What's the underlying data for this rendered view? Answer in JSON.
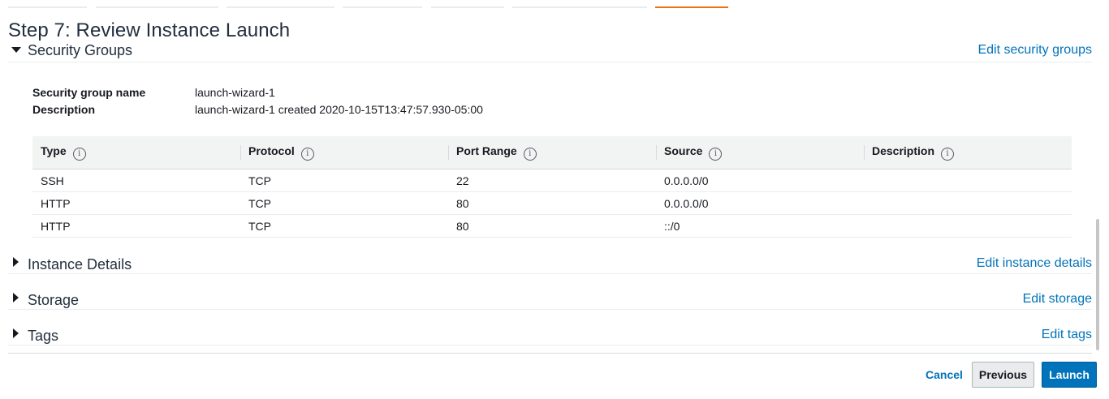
{
  "page": {
    "title": "Step 7: Review Instance Launch"
  },
  "security_groups": {
    "heading": "Security Groups",
    "edit_link": "Edit security groups",
    "name_key": "Security group name",
    "name_value": "launch-wizard-1",
    "desc_key": "Description",
    "desc_value": "launch-wizard-1 created 2020-10-15T13:47:57.930-05:00",
    "info_glyph": "i",
    "columns": [
      "Type",
      "Protocol",
      "Port Range",
      "Source",
      "Description"
    ],
    "rows": [
      {
        "type": "SSH",
        "protocol": "TCP",
        "port": "22",
        "source": "0.0.0.0/0",
        "description": ""
      },
      {
        "type": "HTTP",
        "protocol": "TCP",
        "port": "80",
        "source": "0.0.0.0/0",
        "description": ""
      },
      {
        "type": "HTTP",
        "protocol": "TCP",
        "port": "80",
        "source": "::/0",
        "description": ""
      }
    ]
  },
  "instance_details": {
    "heading": "Instance Details",
    "edit_link": "Edit instance details"
  },
  "storage": {
    "heading": "Storage",
    "edit_link": "Edit storage"
  },
  "tags": {
    "heading": "Tags",
    "edit_link": "Edit tags"
  },
  "footer": {
    "cancel_label": "Cancel",
    "previous_label": "Previous",
    "launch_label": "Launch"
  },
  "colors": {
    "link": "#0073bb",
    "primary_button": "#0073bb",
    "active_step": "#ec7211"
  }
}
